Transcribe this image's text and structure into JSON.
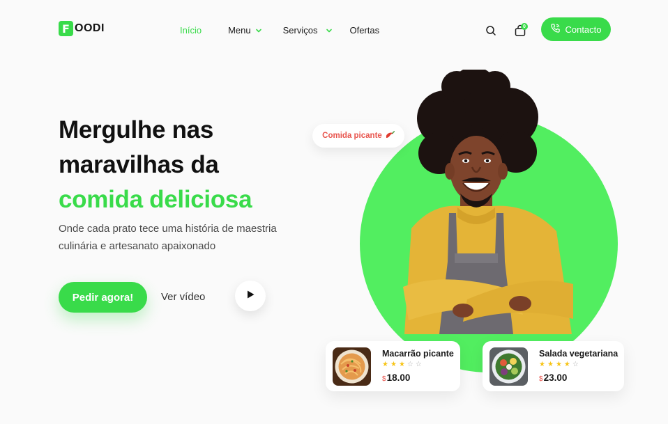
{
  "brand": {
    "badge": "F",
    "text": "OODI"
  },
  "nav": {
    "items": [
      {
        "label": "Início",
        "active": true,
        "dropdown": false
      },
      {
        "label": "Menu",
        "active": false,
        "dropdown": true
      },
      {
        "label": "Serviços",
        "active": false,
        "dropdown": true
      },
      {
        "label": "Ofertas",
        "active": false,
        "dropdown": false
      }
    ]
  },
  "header": {
    "cart_count": "0",
    "contact_label": "Contacto",
    "icons": [
      "search-icon",
      "shopping-bag-icon",
      "phone-icon"
    ]
  },
  "hero": {
    "title_line1": "Mergulhe nas",
    "title_line2": "maravilhas da",
    "title_accent": "comida deliciosa",
    "subtitle": "Onde cada prato tece uma história de maestria culinária e artesanato apaixonado",
    "order_label": "Pedir agora!",
    "video_label": "Ver vídeo",
    "tag_label": "Comida picante"
  },
  "products": [
    {
      "name": "Macarrão picante",
      "rating": 3,
      "max_rating": 5,
      "currency": "$",
      "price": "18.00"
    },
    {
      "name": "Salada vegetariana",
      "rating": 4,
      "max_rating": 5,
      "currency": "$",
      "price": "23.00"
    }
  ],
  "colors": {
    "accent": "#39db4a",
    "circle": "#52ee60",
    "price_symbol": "#e8554e",
    "star": "#f7c416"
  }
}
